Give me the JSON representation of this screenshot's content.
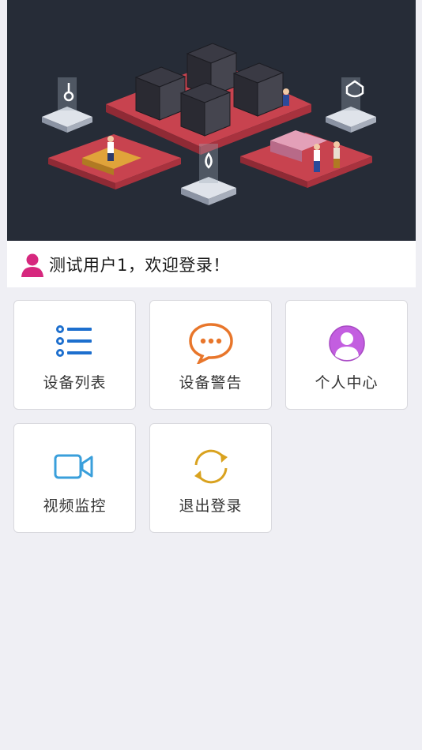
{
  "welcome": {
    "text": "测试用户1，欢迎登录！",
    "icon": "user-icon",
    "icon_color": "#d6287e"
  },
  "menu": [
    {
      "label": "设备列表",
      "icon": "list-icon",
      "color": "#1d6fce"
    },
    {
      "label": "设备警告",
      "icon": "chat-bubble-icon",
      "color": "#e8762b"
    },
    {
      "label": "个人中心",
      "icon": "person-circle-icon",
      "color": "#c35ee0"
    },
    {
      "label": "视频监控",
      "icon": "video-camera-icon",
      "color": "#3a9fdb"
    },
    {
      "label": "退出登录",
      "icon": "refresh-icon",
      "color": "#d9a21f"
    }
  ],
  "banner": {
    "icon": "datacenter-illustration"
  }
}
